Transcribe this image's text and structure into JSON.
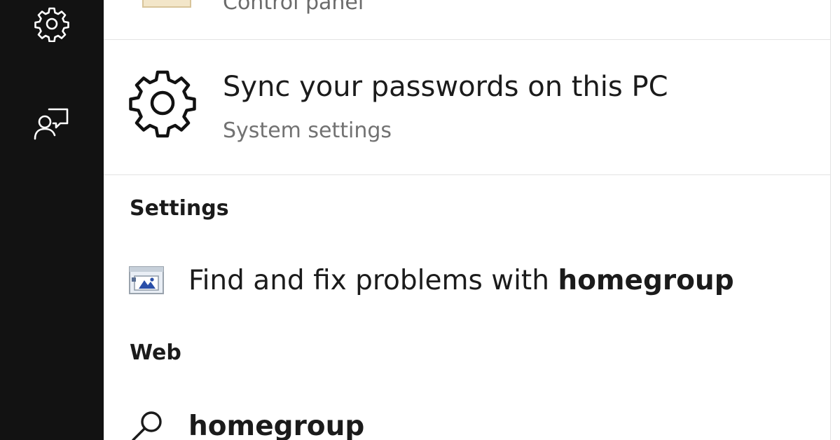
{
  "rail": {
    "items": [
      {
        "icon": "gear-icon",
        "name": "settings"
      },
      {
        "icon": "feedback-icon",
        "name": "feedback"
      }
    ]
  },
  "results": {
    "partial_item": {
      "subtitle": "Control panel"
    },
    "best_match": {
      "icon": "gear-icon",
      "title": "Sync your passwords on this PC",
      "subtitle": "System settings"
    },
    "sections": [
      {
        "header": "Settings",
        "items": [
          {
            "icon": "troubleshooter-icon",
            "text_prefix": "Find and fix problems with ",
            "text_bold": "homegroup"
          }
        ]
      },
      {
        "header": "Web",
        "items": [
          {
            "icon": "search-icon",
            "text_bold": "homegroup"
          }
        ]
      }
    ]
  },
  "colors": {
    "rail_background": "#121212",
    "panel_background": "#ffffff",
    "primary_text": "#1b1b1b",
    "secondary_text": "#727272"
  }
}
